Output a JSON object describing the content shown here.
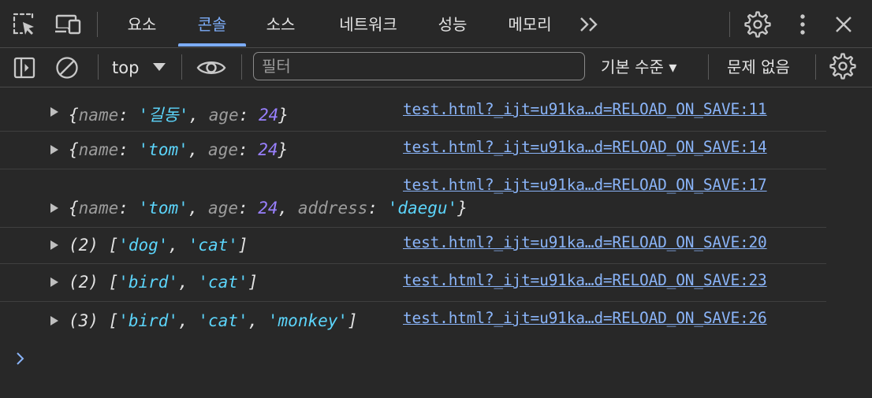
{
  "tabs": [
    "요소",
    "콘솔",
    "소스",
    "네트워크",
    "성능",
    "메모리"
  ],
  "toolbar": {
    "context": "top",
    "filter_placeholder": "필터",
    "levels": "기본 수준 ▾",
    "issues": "문제 없음"
  },
  "icons": [
    "inspect-icon",
    "device-toolbar-icon",
    "more-tabs-icon",
    "settings-icon",
    "kebab-menu-icon",
    "close-icon",
    "sidebar-toggle-icon",
    "clear-console-icon",
    "dropdown-icon",
    "eye-icon",
    "console-settings-icon",
    "prompt-chevron-icon"
  ],
  "colors": {
    "accent": "#7cacf8",
    "link": "#8ab4f8",
    "string": "#5cd5fb",
    "number": "#9980ff",
    "key": "#9d9d9d",
    "background": "#282828"
  },
  "messages": [
    {
      "parts": [
        "{",
        "name",
        ": ",
        "'길동'",
        ", ",
        "age",
        ": ",
        "24",
        "}"
      ],
      "source": "test.html?_ijt=u91ka…d=RELOAD_ON_SAVE:11"
    },
    {
      "parts": [
        "{",
        "name",
        ": ",
        "'tom'",
        ", ",
        "age",
        ": ",
        "24",
        "}"
      ],
      "source": "test.html?_ijt=u91ka…d=RELOAD_ON_SAVE:14"
    },
    {
      "parts": [
        "{",
        "name",
        ": ",
        "'tom'",
        ", ",
        "age",
        ": ",
        "24",
        ", ",
        "address",
        ": ",
        "'daegu'",
        "}"
      ],
      "source": "test.html?_ijt=u91ka…d=RELOAD_ON_SAVE:17"
    },
    {
      "parts": [
        "(2) [",
        "'dog'",
        ", ",
        "'cat'",
        "]"
      ],
      "source": "test.html?_ijt=u91ka…d=RELOAD_ON_SAVE:20"
    },
    {
      "parts": [
        "(2) [",
        "'bird'",
        ", ",
        "'cat'",
        "]"
      ],
      "source": "test.html?_ijt=u91ka…d=RELOAD_ON_SAVE:23"
    },
    {
      "parts": [
        "(3) [",
        "'bird'",
        ", ",
        "'cat'",
        ", ",
        "'monkey'",
        "]"
      ],
      "source": "test.html?_ijt=u91ka…d=RELOAD_ON_SAVE:26"
    }
  ]
}
